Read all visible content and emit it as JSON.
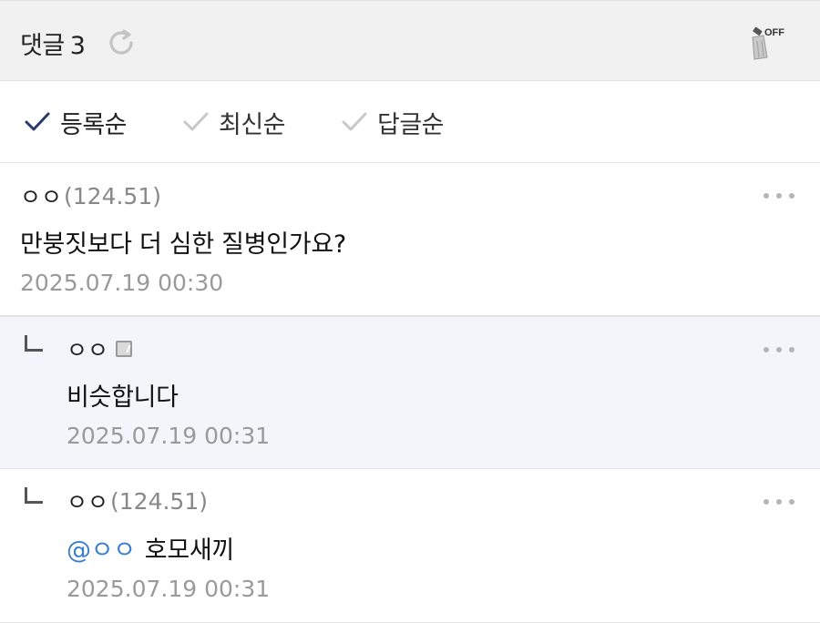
{
  "header": {
    "title": "댓글",
    "count": "3",
    "refresh_icon": "refresh-icon",
    "broom_badge": "OFF"
  },
  "sort": {
    "options": [
      {
        "label": "등록순",
        "active": true
      },
      {
        "label": "최신순",
        "active": false
      },
      {
        "label": "답글순",
        "active": false
      }
    ]
  },
  "comments": [
    {
      "author": "ㅇㅇ",
      "ip": "(124.51)",
      "text": "만붕짓보다 더 심한 질병인가요?",
      "date": "2025.07.19 00:30"
    },
    {
      "author": "ㅇㅇ",
      "ip": "",
      "text": "비슷합니다",
      "date": "2025.07.19 00:31"
    },
    {
      "author": "ㅇㅇ",
      "ip": "(124.51)",
      "mention": "@ㅇㅇ",
      "text": "호모새끼",
      "date": "2025.07.19 00:31"
    }
  ],
  "colors": {
    "header_bg": "#f1f1f1",
    "reply_bg": "#f3f5fb",
    "mention": "#3a7fd0",
    "active_check": "#2b3a6b",
    "inactive_check": "#c8c8c8"
  }
}
